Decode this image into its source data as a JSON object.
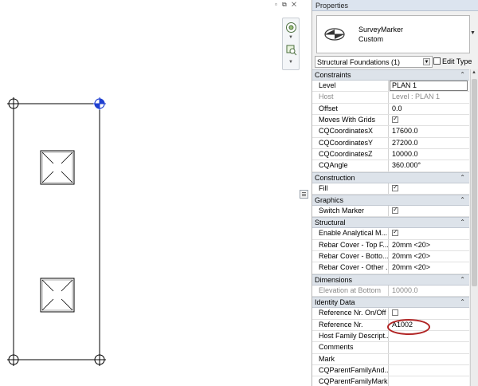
{
  "window_caption_glyphs": "▫ ⧉ ✕",
  "properties": {
    "title": "Properties",
    "type_name": "SurveyMarker",
    "type_sub": "Custom",
    "selector": "Structural Foundations (1)",
    "edit_type": "Edit Type",
    "sections": [
      {
        "title": "Constraints",
        "rows": [
          {
            "label": "Level",
            "value": "PLAN 1"
          },
          {
            "label": "Host",
            "value": "Level : PLAN 1"
          },
          {
            "label": "Offset",
            "value": "0.0"
          },
          {
            "label": "Moves With Grids",
            "checked": true
          },
          {
            "label": "CQCoordinatesX",
            "value": "17600.0"
          },
          {
            "label": "CQCoordinatesY",
            "value": "27200.0"
          },
          {
            "label": "CQCoordinatesZ",
            "value": "10000.0"
          },
          {
            "label": "CQAngle",
            "value": "360.000°"
          }
        ]
      },
      {
        "title": "Construction",
        "rows": [
          {
            "label": "Fill",
            "checked": true
          }
        ]
      },
      {
        "title": "Graphics",
        "rows": [
          {
            "label": "Switch Marker",
            "checked": true
          }
        ]
      },
      {
        "title": "Structural",
        "rows": [
          {
            "label": "Enable Analytical M...",
            "checked": true
          },
          {
            "label": "Rebar Cover - Top F...",
            "value": "20mm <20>"
          },
          {
            "label": "Rebar Cover - Botto...",
            "value": "20mm <20>"
          },
          {
            "label": "Rebar Cover - Other ...",
            "value": "20mm <20>"
          }
        ]
      },
      {
        "title": "Dimensions",
        "rows": [
          {
            "label": "Elevation at Bottom",
            "value": "10000.0"
          }
        ]
      },
      {
        "title": "Identity Data",
        "rows": [
          {
            "label": "Reference Nr. On/Off",
            "checked": false
          },
          {
            "label": "Reference Nr.",
            "value": "A1002"
          },
          {
            "label": "Host Family Descript...",
            "value": ""
          },
          {
            "label": "Comments",
            "value": ""
          },
          {
            "label": "Mark",
            "value": ""
          },
          {
            "label": "CQParentFamilyAnd...",
            "value": ""
          },
          {
            "label": "CQParentFamilyMark",
            "value": ""
          }
        ]
      }
    ]
  },
  "colors": {
    "highlight_ring": "#b12525",
    "selected_grip": "#1f3fd1",
    "section_bg": "#dde3ea"
  },
  "icons": [
    "steering-wheel-icon",
    "zoom-region-icon",
    "type-preview-icon",
    "edit-type-icon",
    "collapse-icon",
    "checkbox-icon"
  ]
}
